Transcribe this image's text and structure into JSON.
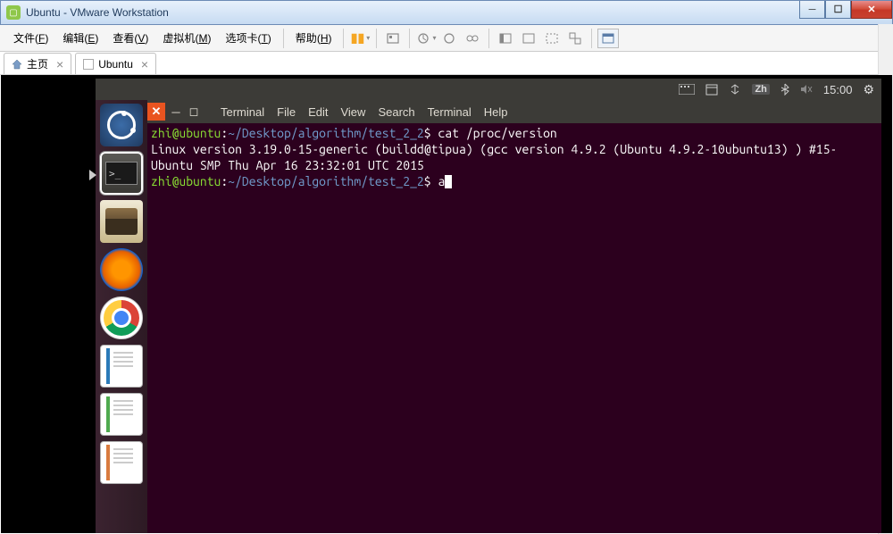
{
  "window_title": "Ubuntu - VMware Workstation",
  "vmware_menu": {
    "file": "文件",
    "file_u": "F",
    "edit": "编辑",
    "edit_u": "E",
    "view": "查看",
    "view_u": "V",
    "vm": "虚拟机",
    "vm_u": "M",
    "tabs": "选项卡",
    "tabs_u": "T",
    "help": "帮助",
    "help_u": "H"
  },
  "vmware_tabs": {
    "home": "主页",
    "ubuntu": "Ubuntu"
  },
  "ubuntu_panel": {
    "ime": "Zh",
    "time": "15:00"
  },
  "terminal_menu": {
    "terminal": "Terminal",
    "file": "File",
    "edit": "Edit",
    "view": "View",
    "search": "Search",
    "terminal2": "Terminal",
    "help": "Help"
  },
  "terminal": {
    "prompt_user": "zhi@ubuntu",
    "prompt_sep": ":",
    "prompt_path": "~/Desktop/algorithm/test_2_2",
    "prompt_end": "$ ",
    "line1_cmd": "cat /proc/version",
    "output": "Linux version 3.19.0-15-generic (buildd@tipua) (gcc version 4.9.2 (Ubuntu 4.9.2-10ubuntu13) ) #15-Ubuntu SMP Thu Apr 16 23:32:01 UTC 2015",
    "line2_cmd": "a"
  }
}
